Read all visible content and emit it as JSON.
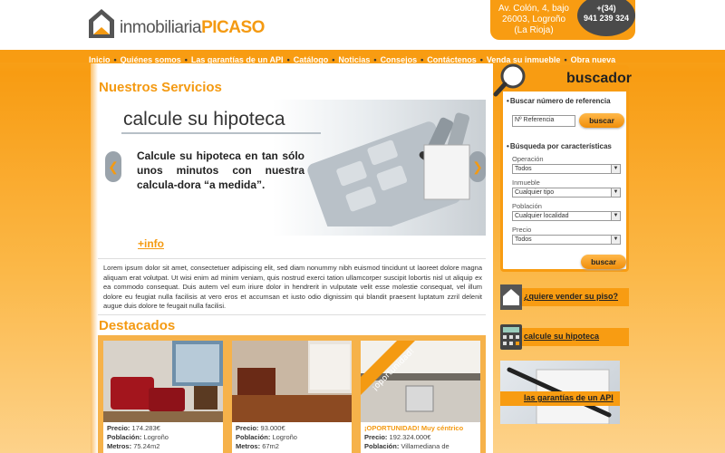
{
  "header": {
    "brand_prefix": "inmobiliaria",
    "brand_name": "PICASO",
    "address_line1": "Av. Colón, 4, bajo",
    "address_line2": "26003, Logroño",
    "address_line3": "(La Rioja)",
    "phone_prefix": "+(34)",
    "phone_number": "941 239 324"
  },
  "nav": {
    "items": [
      "Inicio",
      "Quiénes somos",
      "Las garantías de un API",
      "Catálogo",
      "Noticias",
      "Consejos",
      "Contáctenos",
      "Venda su inmueble",
      "Obra nueva"
    ]
  },
  "main": {
    "services_title": "Nuestros Servicios",
    "slide": {
      "title": "calcule su hipoteca",
      "text": "Calcule su hipoteca en tan sólo unos minutos con nuestra calcula-dora “a medida”.",
      "more_link": "+info",
      "arrow_left": "❮",
      "arrow_right": "❯"
    },
    "lorem": "Lorem ipsum dolor sit amet, consectetuer adipiscing elit, sed diam nonummy nibh euismod tincidunt ut laoreet dolore magna aliquam erat volutpat. Ut wisi enim ad minim veniam, quis nostrud exerci tation ullamcorper suscipit lobortis nisl ut aliquip ex ea commodo consequat. Duis autem vel eum iriure dolor in hendrerit in vulputate velit esse molestie consequat, vel illum dolore eu feugiat nulla facilisis at vero eros et accumsan et iusto odio dignissim qui blandit praesent luptatum zzril delenit augue duis dolore te feugait nulla facilisi.",
    "featured_title": "Destacados",
    "cards": [
      {
        "line1_label": "Precio:",
        "line1_value": "174.283€",
        "line2_label": "Población:",
        "line2_value": "Logroño",
        "line3_label": "Metros:",
        "line3_value": "75.24m2"
      },
      {
        "line1_label": "Precio:",
        "line1_value": "93.000€",
        "line2_label": "Población:",
        "line2_value": "Logroño",
        "line3_label": "Metros:",
        "line3_value": "67m2"
      },
      {
        "headline": "¡OPORTUNIDAD! Muy céntrico",
        "badge": "¡oportunidad!",
        "line1_label": "Precio:",
        "line1_value": "192.324.000€",
        "line2_label": "Población:",
        "line2_value": "Villamediana de"
      }
    ]
  },
  "sidebar": {
    "title": "buscador",
    "ref_label": "Buscar número de referencia",
    "ref_placeholder": "Nº Referencia",
    "search_button": "buscar",
    "features_label": "Búsqueda por características",
    "filters": [
      {
        "label": "Operación",
        "value": "Todos"
      },
      {
        "label": "Inmueble",
        "value": "Cualquier tipo"
      },
      {
        "label": "Población",
        "value": "Cualquier localidad"
      },
      {
        "label": "Precio",
        "value": "Todos"
      }
    ],
    "search_button2": "buscar",
    "promo_sell": "¿quiere vender su piso?",
    "promo_mortgage": "calcule su hipoteca",
    "promo_guarantees": "las garantías de un API"
  },
  "colors": {
    "accent": "#f89c12",
    "dark": "#333333"
  }
}
